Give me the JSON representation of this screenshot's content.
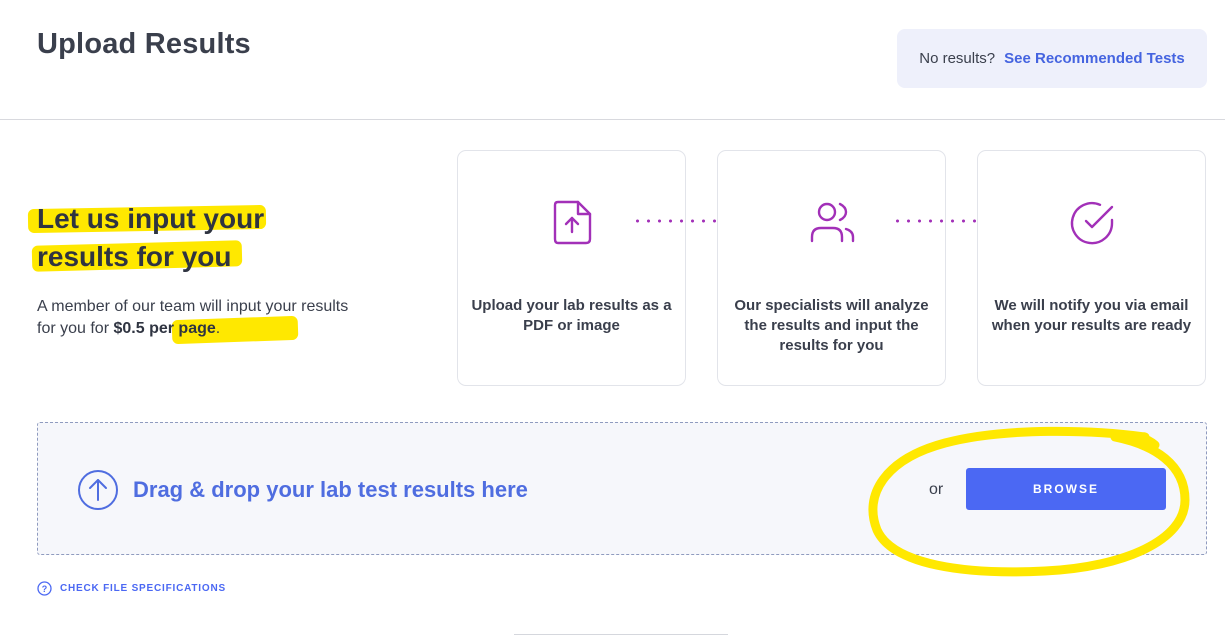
{
  "header": {
    "title": "Upload Results",
    "no_results_text": "No results?",
    "recommended_link": "See Recommended Tests"
  },
  "intro": {
    "heading_line1": "Let us input your",
    "heading_line2": "results for you",
    "text_before": "A member of our team will input your results for you for ",
    "price": "$0.5 per page",
    "text_after": "."
  },
  "steps": [
    {
      "icon": "file-upload-icon",
      "label": "Upload your lab results as a PDF or image"
    },
    {
      "icon": "users-icon",
      "label": "Our specialists will analyze the results and input the results for you"
    },
    {
      "icon": "check-circle-icon",
      "label": "We will notify you via email when your results are ready"
    }
  ],
  "dropzone": {
    "icon": "upload-arrow-icon",
    "text": "Drag & drop your lab test results here",
    "or_text": "or",
    "browse_label": "BROWSE"
  },
  "spec_link": {
    "icon": "help-icon",
    "label": "CHECK FILE SPECIFICATIONS"
  },
  "colors": {
    "accent": "#4b68f3",
    "icon_purple": "#a230b8",
    "highlight": "#ffe800"
  }
}
